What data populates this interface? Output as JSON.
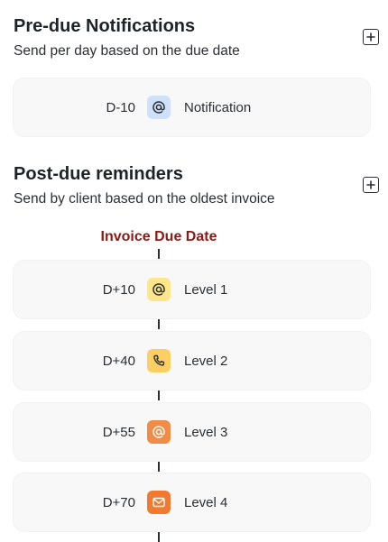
{
  "pre_due": {
    "title": "Pre-due Notifications",
    "subtitle": "Send per day based on the due date",
    "items": [
      {
        "day": "D-10",
        "icon": "at-icon",
        "label": "Notification",
        "badge_color": "#cfe0fb",
        "icon_color": "#2b2f33"
      }
    ]
  },
  "post_due": {
    "title": "Post-due reminders",
    "subtitle": "Send by client based on the oldest invoice",
    "timeline_title": "Invoice Due Date",
    "items": [
      {
        "day": "D+10",
        "icon": "at-icon",
        "label": "Level 1",
        "badge_color": "#fde58a",
        "icon_color": "#2b2f33"
      },
      {
        "day": "D+40",
        "icon": "phone-icon",
        "label": "Level 2",
        "badge_color": "#fbcf64",
        "icon_color": "#2b2f33"
      },
      {
        "day": "D+55",
        "icon": "at-icon",
        "label": "Level 3",
        "badge_color": "#f28b45",
        "icon_color": "#ffffff"
      },
      {
        "day": "D+70",
        "icon": "envelope-icon",
        "label": "Level 4",
        "badge_color": "#ef7a30",
        "icon_color": "#ffffff"
      }
    ]
  },
  "colors": {
    "timeline_title": "#8b1a12",
    "card_background": "#f8f8f8"
  }
}
